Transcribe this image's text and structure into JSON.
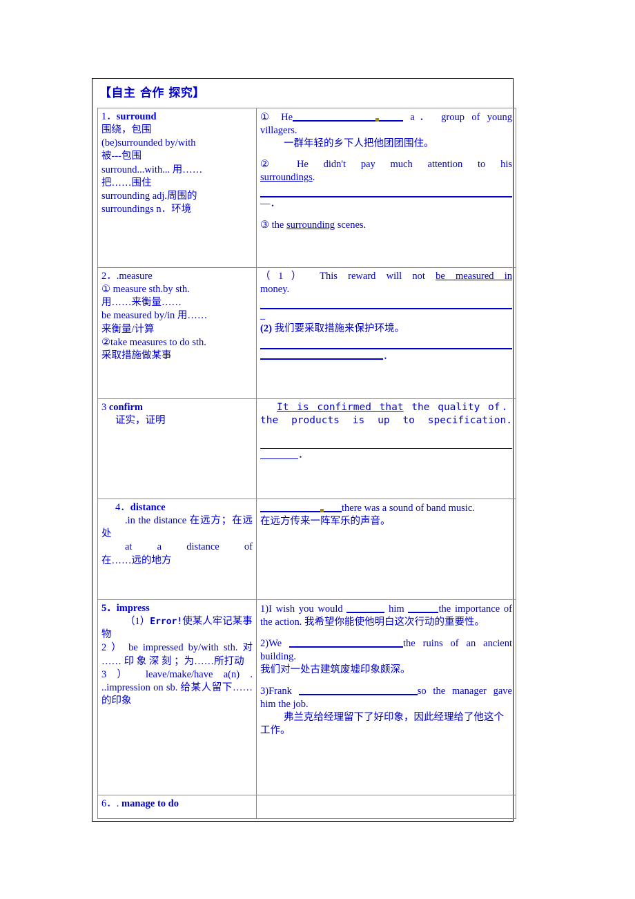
{
  "document": {
    "title": "【自主 合作 探究】"
  },
  "entries": [
    {
      "id": "surround",
      "left": {
        "headword_num": "1．",
        "headword": "surround",
        "lines": [
          "围绕，包围",
          "(be)surrounded by/with",
          "被---包围",
          "surround...with... 用……",
          "把……围住",
          "surrounding adj.周围的",
          "surroundings n．环境"
        ],
        "pos_italic": [
          "adj.",
          "n."
        ]
      },
      "right": {
        "item1_marker": "①",
        "item1_pre": "He",
        "item1_post": "a． group of young villagers.",
        "item1_cn": "一群年轻的乡下人把他团团围住。",
        "item2_marker": "②",
        "item2_text": "He didn't pay much attention to his ",
        "item2_underlined": "surroundings",
        "item2_tail": ".",
        "item2_answer_tail": "—．",
        "item3_marker": "③",
        "item3_pre": "the ",
        "item3_underlined": "surrounding",
        "item3_post": " scenes."
      }
    },
    {
      "id": "measure",
      "left": {
        "headword_num": "2．",
        "headword": ".measure",
        "lines": [
          "① measure sth.by sth.",
          "用……来衡量……",
          "be measured by/in 用……",
          "来衡量/计算",
          "②take measures to do sth.",
          "采取措施做某事"
        ]
      },
      "right": {
        "item1_marker": "（1）",
        "item1_text": "This reward will not ",
        "item1_underlined": "be measured in",
        "item1_tail": " money.",
        "item1_answer_tail": "_",
        "item2_marker": "(2)",
        "item2_cn": "我们要采取措施来保护环境。",
        "item2_answer_tail": "．"
      }
    },
    {
      "id": "confirm",
      "left": {
        "headword_num": "3",
        "headword": "confirm",
        "lines": [
          "证实，证明"
        ]
      },
      "right": {
        "sentence_underlined": "It is confirmed that",
        "sentence_rest": "the quality of． the products is up to specification.",
        "answer_tail": "．"
      }
    },
    {
      "id": "distance",
      "left": {
        "headword_num": "4．",
        "headword": "distance",
        "lines": [
          ".in the distance 在远方；在远处",
          "at a distance of",
          "在……远的地方"
        ]
      },
      "right": {
        "item1_post": "there was a sound of band music.",
        "item1_cn": "在远方传来一阵军乐的声音。"
      }
    },
    {
      "id": "impress",
      "left": {
        "headword_num": "5．",
        "headword": "impress",
        "line1_marker": "（1）",
        "line1_error": "Error!",
        "line1_cn": "使某人牢记某事物",
        "line2": "2 ） be impressed by/with sth. 对 …… 印 象 深 刻 ；为……所打动",
        "line3": "3 ） leave/make/have a(n) . ..impression on sb. 给某人留下……的印象"
      },
      "right": {
        "item1_marker": "1)",
        "item1_a": "I wish you would",
        "item1_b": "him",
        "item1_c": "the importance of the action.",
        "item1_cn": "我希望你能使他明白这次行动的重要性。",
        "item2_marker": "2)",
        "item2_a": "We",
        "item2_b": "the ruins of an ancient building.",
        "item2_cn": "我们对一处古建筑废墟印象颇深。",
        "item3_marker": "3)",
        "item3_a": "Frank",
        "item3_b": "so the manager gave him the job.",
        "item3_cn": "弗兰克给经理留下了好印象，因此经理给了他这个工作。"
      }
    },
    {
      "id": "manage",
      "left": {
        "headword_num": "6．.",
        "headword": "manage to do"
      },
      "right": {}
    }
  ],
  "colors": {
    "text_blue": "#0000CC",
    "border_gray": "#8a8a8a",
    "frame_black": "#000000",
    "blank_marker": "#9a8b20"
  }
}
